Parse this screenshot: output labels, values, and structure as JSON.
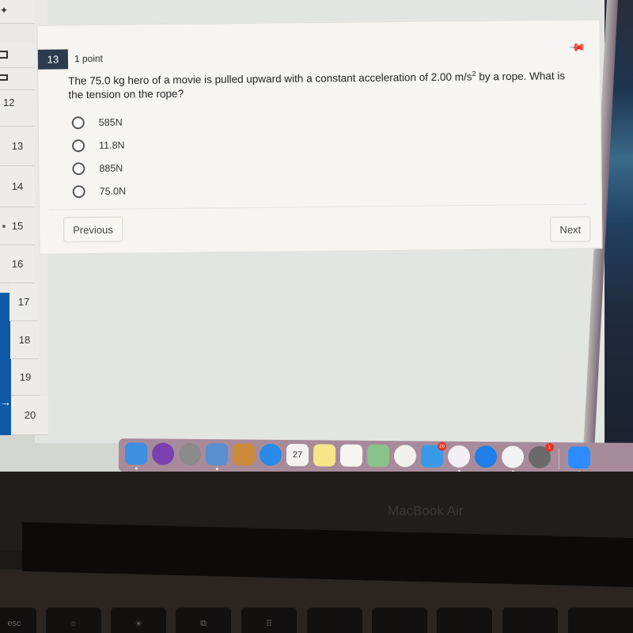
{
  "sidebar": {
    "question_numbers": [
      "12",
      "13",
      "14",
      "15",
      "16",
      "17",
      "18",
      "19",
      "20"
    ]
  },
  "question": {
    "number": "13",
    "points": "1 point",
    "text_part1": "The 75.0 kg hero of a movie is pulled upward with a constant acceleration of 2.00 m/s",
    "text_sup": "2",
    "text_part2": " by a rope. What is the tension on the rope?",
    "options": [
      {
        "label": "585N",
        "selected": false
      },
      {
        "label": "11.8N",
        "selected": false
      },
      {
        "label": "885N",
        "selected": false
      },
      {
        "label": "75.0N",
        "selected": false
      }
    ]
  },
  "nav": {
    "previous_label": "Previous",
    "next_label": "Next"
  },
  "dock": {
    "apps": [
      {
        "name": "Finder",
        "color": "#3d8fe0",
        "running": true
      },
      {
        "name": "Siri",
        "color": "#7a3fb0",
        "running": false
      },
      {
        "name": "Launchpad",
        "color": "#8a8a8a",
        "running": false
      },
      {
        "name": "Preview",
        "color": "#5a8fd0",
        "running": true
      },
      {
        "name": "Contacts",
        "color": "#c98a3a",
        "running": false
      },
      {
        "name": "Safari",
        "color": "#2a8ae8",
        "running": false
      },
      {
        "name": "Calendar",
        "color": "#f4f2ef",
        "running": false,
        "text": "27"
      },
      {
        "name": "Notes",
        "color": "#f7e58a",
        "running": false
      },
      {
        "name": "Reminders",
        "color": "#f6f5f2",
        "running": false
      },
      {
        "name": "Maps",
        "color": "#8ac48a",
        "running": false
      },
      {
        "name": "Photos",
        "color": "#f2f0ec",
        "running": false
      },
      {
        "name": "Messages",
        "color": "#3a9ae8",
        "running": false,
        "badge": "26"
      },
      {
        "name": "Music",
        "color": "#f3eef4",
        "running": true
      },
      {
        "name": "App Store",
        "color": "#1f7ee8",
        "running": false
      },
      {
        "name": "Chrome",
        "color": "#f2f2f2",
        "running": true
      },
      {
        "name": "System Preferences",
        "color": "#6a6a6a",
        "running": false,
        "badge": "1"
      },
      {
        "name": "Zoom",
        "color": "#2d8cff",
        "running": true
      }
    ]
  },
  "laptop": {
    "brand": "MacBook Air",
    "keys": [
      "esc",
      "F1",
      "F2",
      "F3",
      "F4"
    ]
  }
}
